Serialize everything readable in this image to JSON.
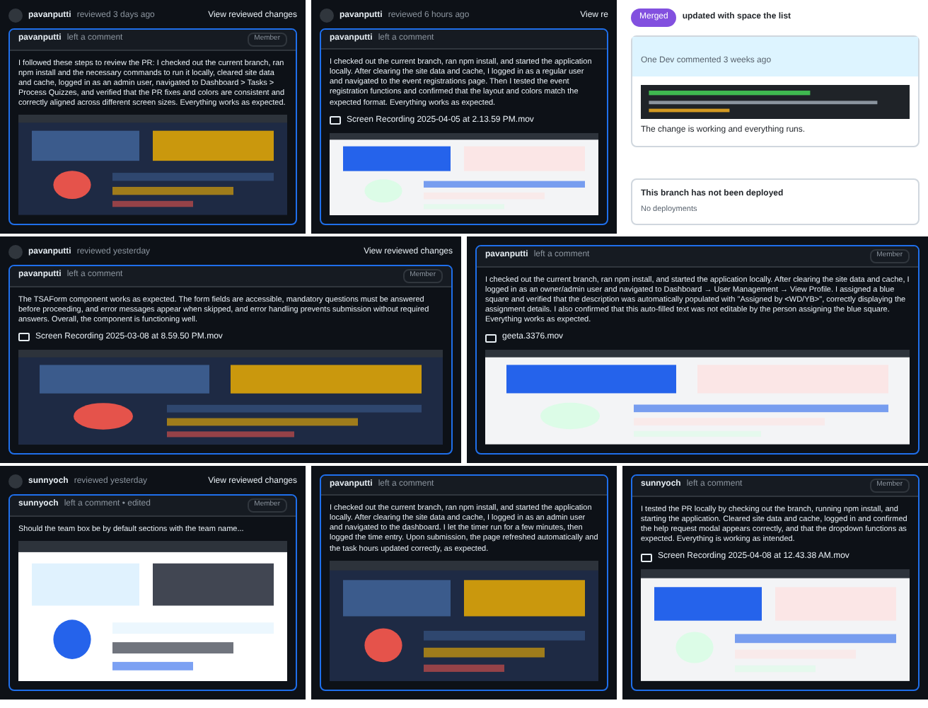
{
  "rows": [
    [
      {
        "kind": "dark",
        "review": {
          "author": "pavanputti",
          "action": "reviewed 3 days ago",
          "link": "View reviewed changes"
        },
        "comment": {
          "author": "pavanputti",
          "action": "left a comment",
          "badge": "Member",
          "text": "I followed these steps to review the PR: I checked out the current branch, ran npm install and the necessary commands to run it locally, cleared site data and cache, logged in as an admin user, navigated to Dashboard > Tasks > Process Quizzes, and verified that the PR fixes and colors are consistent and correctly aligned across different screen sizes. Everything works as expected."
        }
      },
      {
        "kind": "dark",
        "review": {
          "author": "pavanputti",
          "action": "reviewed 6 hours ago",
          "link": "View re"
        },
        "comment": {
          "author": "pavanputti",
          "action": "left a comment",
          "text": "I checked out the current branch, ran npm install, and started the application locally. After clearing the site data and cache, I logged in as a regular user and navigated to the event registrations page. Then I tested the event registration functions and confirmed that the layout and colors match the expected format. Everything works as expected.",
          "attachment": "Screen Recording 2025-04-05 at 2.13.59 PM.mov"
        }
      },
      {
        "kind": "light",
        "badge": "Merged",
        "event": "updated with space the list",
        "commenter": "One Dev commented 3 weeks ago",
        "note": "The change is working and everything runs.",
        "deploy": "This branch has not been deployed",
        "deploy_note": "No deployments"
      }
    ],
    [
      {
        "kind": "dark",
        "review": {
          "author": "pavanputti",
          "action": "reviewed yesterday",
          "link": "View reviewed changes"
        },
        "comment": {
          "author": "pavanputti",
          "action": "left a comment",
          "badge": "Member",
          "text": "The TSAForm component works as expected. The form fields are accessible, mandatory questions must be answered before proceeding, and error messages appear when skipped, and error handling prevents submission without required answers. Overall, the component is functioning well.",
          "attachment": "Screen Recording 2025-03-08 at 8.59.50 PM.mov"
        }
      },
      {
        "kind": "dark",
        "comment": {
          "author": "pavanputti",
          "action": "left a comment",
          "badge": "Member",
          "text": "I checked out the current branch, ran npm install, and started the application locally. After clearing the site data and cache, I logged in as an owner/admin user and navigated to Dashboard → User Management → View Profile. I assigned a blue square and verified that the description was automatically populated with \"Assigned by <WD/YB>\", correctly displaying the assignment details. I also confirmed that this auto-filled text was not editable by the person assigning the blue square. Everything works as expected.",
          "attachment": "geeta.3376.mov"
        }
      }
    ],
    [
      {
        "kind": "dark",
        "review": {
          "author": "sunnyoch",
          "action": "reviewed yesterday",
          "link": "View reviewed changes"
        },
        "comment": {
          "author": "sunnyoch",
          "action": "left a comment • edited",
          "badge": "Member",
          "text": "Should the team box be by default sections with the team name..."
        }
      },
      {
        "kind": "dark",
        "comment": {
          "author": "pavanputti",
          "action": "left a comment",
          "text": "I checked out the current branch, ran npm install, and started the application locally. After clearing the site data and cache, I logged in as an admin user and navigated to the dashboard. I let the timer run for a few minutes, then logged the time entry. Upon submission, the page refreshed automatically and the task hours updated correctly, as expected."
        }
      },
      {
        "kind": "dark",
        "comment": {
          "author": "sunnyoch",
          "action": "left a comment",
          "badge": "Member",
          "text": "I tested the PR locally by checking out the branch, running npm install, and starting the application. Cleared site data and cache, logged in and confirmed the help request modal appears correctly, and that the dropdown functions as expected. Everything is working as intended.",
          "attachment": "Screen Recording 2025-04-08 at 12.43.38 AM.mov"
        }
      }
    ]
  ]
}
